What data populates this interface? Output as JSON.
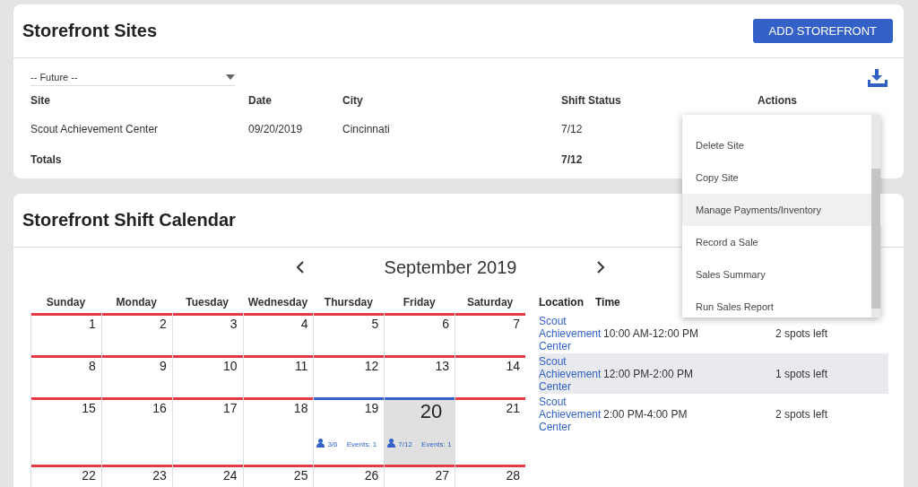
{
  "sites_card": {
    "title": "Storefront Sites",
    "add_button": "ADD STOREFRONT",
    "filter": {
      "value": "-- Future --"
    },
    "columns": [
      "Site",
      "Date",
      "City",
      "Shift Status",
      "Actions"
    ],
    "rows": [
      {
        "site": "Scout Achievement Center",
        "date": "09/20/2019",
        "city": "Cincinnati",
        "shift_status": "7/12"
      }
    ],
    "totals": {
      "label": "Totals",
      "shift_status": "7/12"
    }
  },
  "actions_menu": {
    "items": [
      {
        "label": "Delete Site",
        "hovered": false
      },
      {
        "label": "Copy Site",
        "hovered": false
      },
      {
        "label": "Manage Payments/Inventory",
        "hovered": true
      },
      {
        "label": "Record a Sale",
        "hovered": false
      },
      {
        "label": "Sales Summary",
        "hovered": false
      },
      {
        "label": "Run Sales Report",
        "hovered": false
      }
    ]
  },
  "calendar_card": {
    "title": "Storefront Shift Calendar",
    "month": "September 2019",
    "weekdays": [
      "Sunday",
      "Monday",
      "Tuesday",
      "Wednesday",
      "Thursday",
      "Friday",
      "Saturday"
    ],
    "weeks": [
      [
        {
          "day": "1",
          "color": "#e63946",
          "selected": false
        },
        {
          "day": "2",
          "color": "#e63946",
          "selected": false
        },
        {
          "day": "3",
          "color": "#e63946",
          "selected": false
        },
        {
          "day": "4",
          "color": "#e63946",
          "selected": false
        },
        {
          "day": "5",
          "color": "#e63946",
          "selected": false
        },
        {
          "day": "6",
          "color": "#e63946",
          "selected": false
        },
        {
          "day": "7",
          "color": "#e63946",
          "selected": false
        }
      ],
      [
        {
          "day": "8",
          "color": "#e63946",
          "selected": false
        },
        {
          "day": "9",
          "color": "#e63946",
          "selected": false
        },
        {
          "day": "10",
          "color": "#e63946",
          "selected": false
        },
        {
          "day": "11",
          "color": "#e63946",
          "selected": false
        },
        {
          "day": "12",
          "color": "#e63946",
          "selected": false
        },
        {
          "day": "13",
          "color": "#e63946",
          "selected": false
        },
        {
          "day": "14",
          "color": "#e63946",
          "selected": false
        }
      ],
      [
        {
          "day": "15",
          "color": "#e63946",
          "selected": false
        },
        {
          "day": "16",
          "color": "#e63946",
          "selected": false
        },
        {
          "day": "17",
          "color": "#e63946",
          "selected": false
        },
        {
          "day": "18",
          "color": "#e63946",
          "selected": false
        },
        {
          "day": "19",
          "color": "#3361c7",
          "selected": false,
          "shifts": "3/6",
          "events": "Events: 1"
        },
        {
          "day": "20",
          "color": "#3361c7",
          "selected": true,
          "shifts": "7/12",
          "events": "Events: 1"
        },
        {
          "day": "21",
          "color": "#e63946",
          "selected": false
        }
      ],
      [
        {
          "day": "22",
          "color": "#e63946",
          "selected": false
        },
        {
          "day": "23",
          "color": "#e63946",
          "selected": false
        },
        {
          "day": "24",
          "color": "#e63946",
          "selected": false
        },
        {
          "day": "25",
          "color": "#e63946",
          "selected": false
        },
        {
          "day": "26",
          "color": "#e63946",
          "selected": false
        },
        {
          "day": "27",
          "color": "#e63946",
          "selected": false
        },
        {
          "day": "28",
          "color": "#e63946",
          "selected": false
        }
      ]
    ],
    "shift_columns": [
      "Location",
      "Time"
    ],
    "shifts": [
      {
        "location": "Scout Achievement Center",
        "time": "10:00 AM-12:00 PM",
        "spots": "2 spots left",
        "selected": false
      },
      {
        "location": "Scout Achievement Center",
        "time": "12:00 PM-2:00 PM",
        "spots": "1 spots left",
        "selected": true
      },
      {
        "location": "Scout Achievement Center",
        "time": "2:00 PM-4:00 PM",
        "spots": "2 spots left",
        "selected": false
      }
    ]
  }
}
